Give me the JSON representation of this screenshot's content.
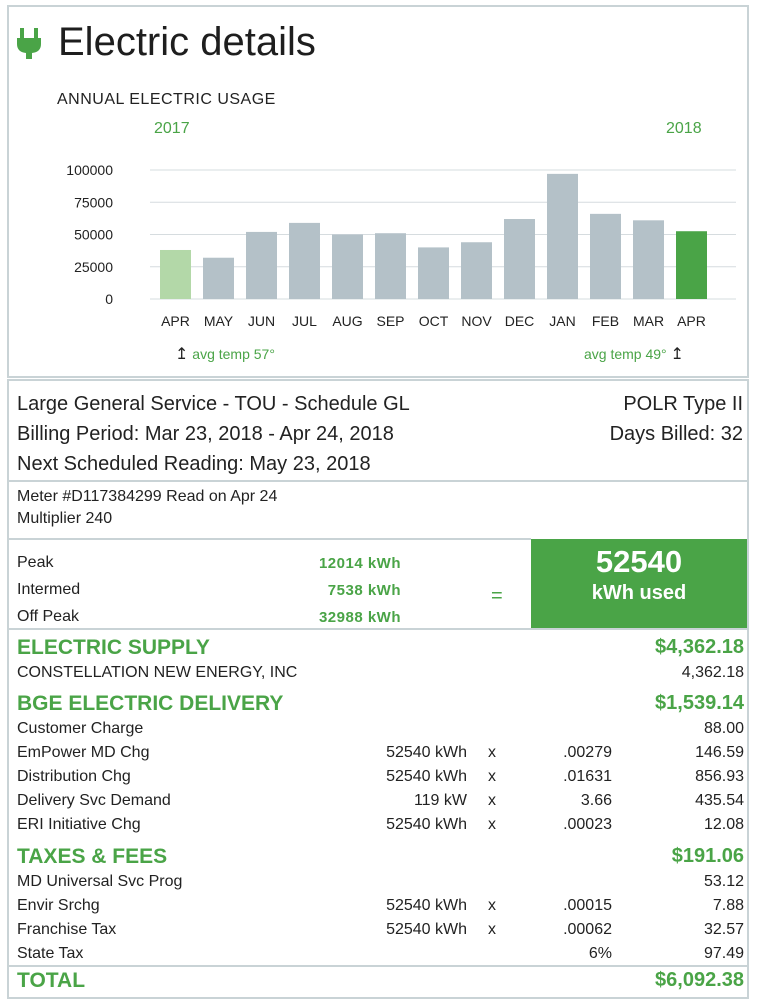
{
  "header": {
    "title": "Electric details",
    "icon": "plug-icon"
  },
  "chart_section": {
    "title": "ANNUAL ELECTRIC USAGE",
    "year_start": "2017",
    "year_end": "2018",
    "temp_start": "avg temp 57°",
    "temp_end": "avg temp 49°"
  },
  "chart_data": {
    "type": "bar",
    "categories": [
      "APR",
      "MAY",
      "JUN",
      "JUL",
      "AUG",
      "SEP",
      "OCT",
      "NOV",
      "DEC",
      "JAN",
      "FEB",
      "MAR",
      "APR"
    ],
    "values": [
      38000,
      32000,
      52000,
      59000,
      50000,
      51000,
      40000,
      44000,
      62000,
      97000,
      66000,
      61000,
      52540
    ],
    "yticks": [
      0,
      25000,
      50000,
      75000,
      100000
    ],
    "ylim": [
      0,
      100000
    ],
    "grid": true,
    "colors": {
      "default": "#b4c1c8",
      "first": "#b3d8a8",
      "last": "#4aa447"
    }
  },
  "service": {
    "name": "Large General Service - TOU - Schedule GL",
    "type": "POLR Type II",
    "billing_period": "Billing Period: Mar 23, 2018 - Apr 24, 2018",
    "days_billed": "Days Billed: 32",
    "next_reading": "Next Scheduled Reading: May 23, 2018"
  },
  "meter": {
    "line1": "Meter #D117384299  Read on Apr 24",
    "line2": "Multiplier 240"
  },
  "readings": [
    {
      "label": "Peak",
      "value": "12014 kWh"
    },
    {
      "label": "Intermed",
      "value": "7538 kWh"
    },
    {
      "label": "Off Peak",
      "value": "32988 kWh"
    }
  ],
  "equals_sign": "=",
  "usage_total": {
    "value": "52540",
    "label": "kWh used"
  },
  "supply": {
    "title": "ELECTRIC SUPPLY",
    "total": "$4,362.18",
    "lines": [
      {
        "label": "CONSTELLATION  NEW ENERGY,  INC",
        "qty": "",
        "x": "",
        "rate": "",
        "amount": "4,362.18"
      }
    ]
  },
  "delivery": {
    "title": "BGE ELECTRIC DELIVERY",
    "total": "$1,539.14",
    "lines": [
      {
        "label": "Customer Charge",
        "qty": "",
        "x": "",
        "rate": "",
        "amount": "88.00"
      },
      {
        "label": "EmPower MD Chg",
        "qty": "52540 kWh",
        "x": "x",
        "rate": ".00279",
        "amount": "146.59"
      },
      {
        "label": "Distribution Chg",
        "qty": "52540 kWh",
        "x": "x",
        "rate": ".01631",
        "amount": "856.93"
      },
      {
        "label": "Delivery Svc Demand",
        "qty": "119 kW",
        "x": "x",
        "rate": "3.66",
        "amount": "435.54"
      },
      {
        "label": "ERI Initiative Chg",
        "qty": "52540 kWh",
        "x": "x",
        "rate": ".00023",
        "amount": "12.08"
      }
    ]
  },
  "taxes": {
    "title": "TAXES & FEES",
    "total": "$191.06",
    "lines": [
      {
        "label": "MD Universal Svc Prog",
        "qty": "",
        "x": "",
        "rate": "",
        "amount": "53.12"
      },
      {
        "label": "Envir Srchg",
        "qty": "52540 kWh",
        "x": "x",
        "rate": ".00015",
        "amount": "7.88"
      },
      {
        "label": "Franchise Tax",
        "qty": "52540 kWh",
        "x": "x",
        "rate": ".00062",
        "amount": "32.57"
      },
      {
        "label": "State Tax",
        "qty": "",
        "x": "",
        "rate": "6%",
        "amount": "97.49"
      }
    ]
  },
  "total": {
    "label": "TOTAL",
    "amount": "$6,092.38"
  }
}
